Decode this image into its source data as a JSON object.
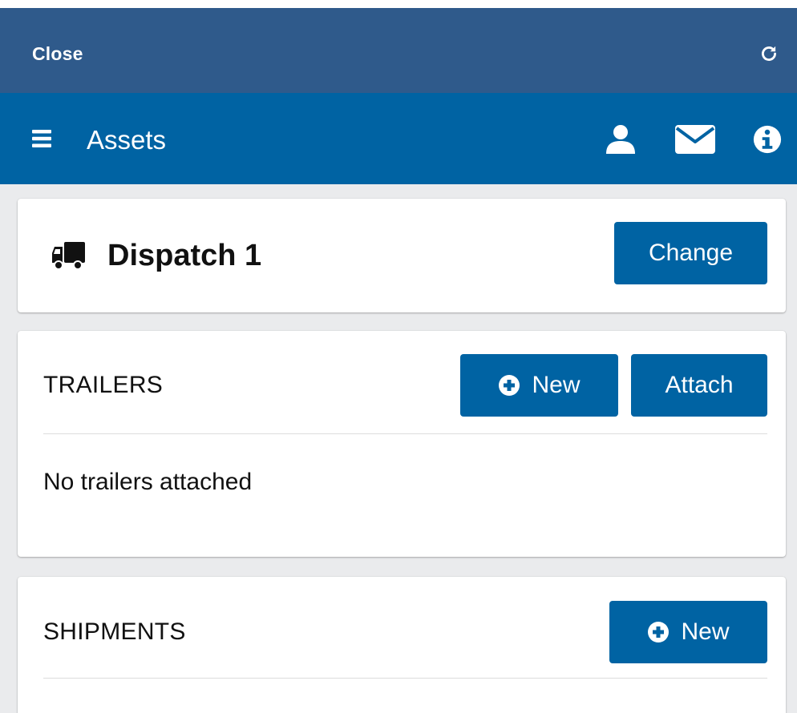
{
  "topbar": {
    "close_label": "Close",
    "refresh_icon": "refresh-icon"
  },
  "navbar": {
    "title": "Assets",
    "menu_icon": "hamburger-menu-icon",
    "icons": [
      "user-icon",
      "mail-icon",
      "info-icon"
    ]
  },
  "dispatch": {
    "icon": "truck-icon",
    "name": "Dispatch 1",
    "change_label": "Change"
  },
  "trailers": {
    "title": "TRAILERS",
    "new_label": "New",
    "attach_label": "Attach",
    "empty_message": "No trailers attached"
  },
  "shipments": {
    "title": "SHIPMENTS",
    "new_label": "New"
  },
  "colors": {
    "topbar": "#2f5a8b",
    "navbar": "#0063a3",
    "button": "#0063a3",
    "background": "#eaebed",
    "card": "#ffffff"
  }
}
